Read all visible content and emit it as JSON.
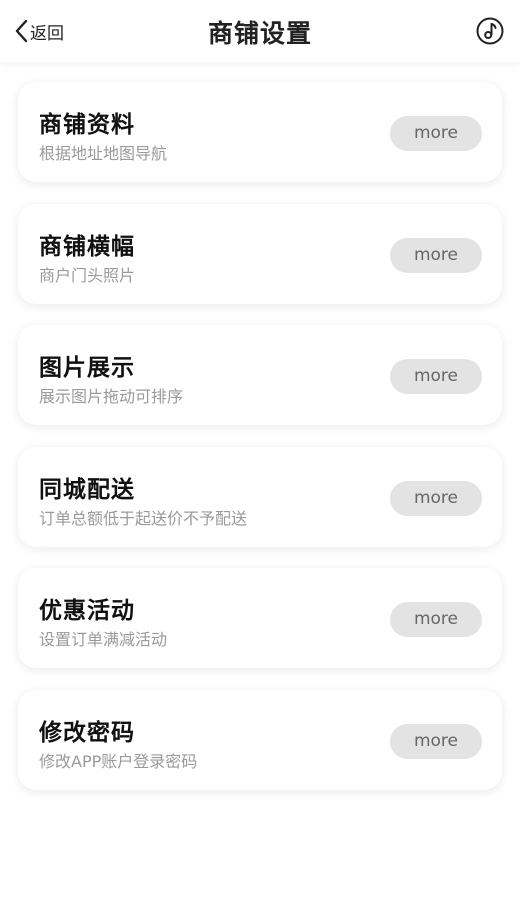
{
  "header": {
    "back_label": "返回",
    "title": "商铺设置",
    "menu_icon": "music-note-circle-icon"
  },
  "cards": [
    {
      "title": "商铺资料",
      "subtitle": "根据地址地图导航",
      "button": "more"
    },
    {
      "title": "商铺横幅",
      "subtitle": "商户门头照片",
      "button": "more"
    },
    {
      "title": "图片展示",
      "subtitle": "展示图片拖动可排序",
      "button": "more"
    },
    {
      "title": "同城配送",
      "subtitle": "订单总额低于起送价不予配送",
      "button": "more"
    },
    {
      "title": "优惠活动",
      "subtitle": "设置订单满减活动",
      "button": "more"
    },
    {
      "title": "修改密码",
      "subtitle": "修改APP账户登录密码",
      "button": "more"
    }
  ],
  "colors": {
    "button_bg": "#e3e3e3",
    "subtitle": "#9a9a9a"
  }
}
